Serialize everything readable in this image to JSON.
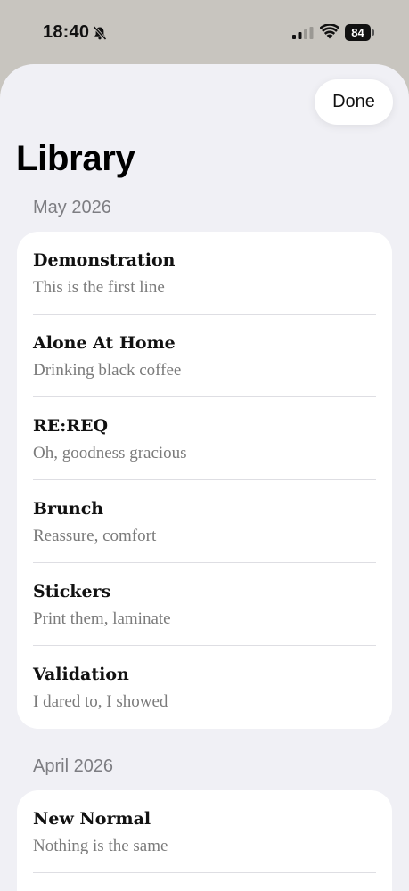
{
  "status_bar": {
    "time": "18:40",
    "battery": "84"
  },
  "header": {
    "done_label": "Done",
    "title": "Library"
  },
  "sections": [
    {
      "header": "May 2026",
      "items": [
        {
          "title": "Demonstration",
          "subtitle": "This is the first line"
        },
        {
          "title": "Alone At Home",
          "subtitle": "Drinking black coffee"
        },
        {
          "title": "RE:REQ",
          "subtitle": "Oh, goodness gracious"
        },
        {
          "title": "Brunch",
          "subtitle": "Reassure, comfort"
        },
        {
          "title": "Stickers",
          "subtitle": "Print them, laminate"
        },
        {
          "title": "Validation",
          "subtitle": "I dared to, I showed"
        }
      ]
    },
    {
      "header": "April 2026",
      "items": [
        {
          "title": "New Normal",
          "subtitle": "Nothing is the same"
        }
      ]
    }
  ],
  "colors": {
    "background": "#f0f0f5",
    "card": "#ffffff",
    "secondary_text": "#7b7b7b"
  }
}
